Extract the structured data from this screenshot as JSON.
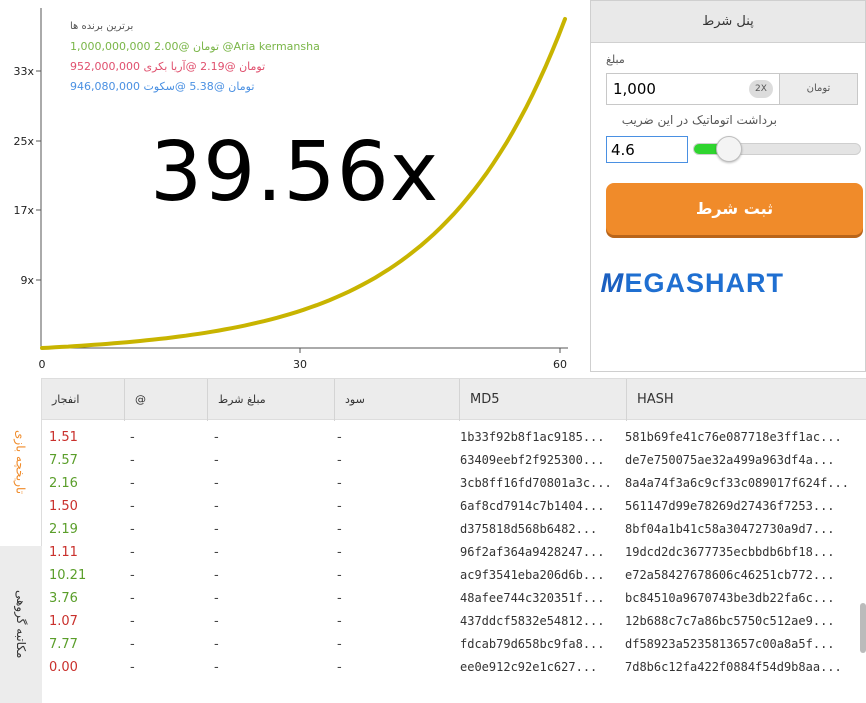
{
  "chart": {
    "multiplier_text": "39.56x",
    "curve_color": "#c8b400",
    "x_ticks": [
      "0",
      "30",
      "60"
    ],
    "y_ticks": [
      "9x",
      "17x",
      "25x",
      "33x"
    ],
    "top_winners": {
      "title": "برترین برنده ها",
      "entries": [
        {
          "text": "1,000,000,000 تومان @2.00 @Aria kermansha",
          "color": "#7ab648"
        },
        {
          "text": "952,000,000 تومان @2.19 @آریا بکری",
          "color": "#e0506e"
        },
        {
          "text": "946,080,000 تومان @5.38 @سکوت",
          "color": "#4a90e2"
        }
      ]
    }
  },
  "bet_panel": {
    "title": "پنل شرط",
    "amount_label": "مبلغ",
    "amount_value": "1,000",
    "double_label": "2X",
    "currency_label": "تومان",
    "auto_cashout_label": "برداشت اتوماتیک در این ضریب",
    "auto_cashout_value": "4.6",
    "slider_fill_fraction": 0.22,
    "submit_label": "ثبت شرط",
    "logo_m": "M",
    "logo_rest": "EGASHART",
    "accent_color": "#f08b2a",
    "slider_color": "#2fd52f"
  },
  "side_tabs": {
    "history": "تاریخچه بازی",
    "chat": "مکاتبه گروهی"
  },
  "table": {
    "headers": {
      "crash": "انفجار",
      "at": "@",
      "bet": "مبلغ شرط",
      "profit": "سود",
      "md5": "MD5",
      "hash": "HASH"
    },
    "rows": [
      {
        "crash": "1.51",
        "status": "red",
        "at": "-",
        "bet": "-",
        "profit": "-",
        "md5": "1b33f92b8f1ac9185...",
        "hash": "581b69fe41c76e087718e3ff1ac..."
      },
      {
        "crash": "7.57",
        "status": "green",
        "at": "-",
        "bet": "-",
        "profit": "-",
        "md5": "63409eebf2f925300...",
        "hash": "de7e750075ae32a499a963df4a..."
      },
      {
        "crash": "2.16",
        "status": "green",
        "at": "-",
        "bet": "-",
        "profit": "-",
        "md5": "3cb8ff16fd70801a3c...",
        "hash": "8a4a74f3a6c9cf33c089017f624f..."
      },
      {
        "crash": "1.50",
        "status": "red",
        "at": "-",
        "bet": "-",
        "profit": "-",
        "md5": "6af8cd7914c7b1404...",
        "hash": "561147d99e78269d27436f7253..."
      },
      {
        "crash": "2.19",
        "status": "green",
        "at": "-",
        "bet": "-",
        "profit": "-",
        "md5": "d375818d568b6482...",
        "hash": "8bf04a1b41c58a30472730a9d7..."
      },
      {
        "crash": "1.11",
        "status": "red",
        "at": "-",
        "bet": "-",
        "profit": "-",
        "md5": "96f2af364a9428247...",
        "hash": "19dcd2dc3677735ecbbdb6bf18..."
      },
      {
        "crash": "10.21",
        "status": "green",
        "at": "-",
        "bet": "-",
        "profit": "-",
        "md5": "ac9f3541eba206d6b...",
        "hash": "e72a58427678606c46251cb772..."
      },
      {
        "crash": "3.76",
        "status": "green",
        "at": "-",
        "bet": "-",
        "profit": "-",
        "md5": "48afee744c320351f...",
        "hash": "bc84510a9670743be3db22fa6c..."
      },
      {
        "crash": "1.07",
        "status": "red",
        "at": "-",
        "bet": "-",
        "profit": "-",
        "md5": "437ddcf5832e54812...",
        "hash": "12b688c7c7a86bc5750c512ae9..."
      },
      {
        "crash": "7.77",
        "status": "green",
        "at": "-",
        "bet": "-",
        "profit": "-",
        "md5": "fdcab79d658bc9fa8...",
        "hash": "df58923a5235813657c00a8a5f..."
      },
      {
        "crash": "0.00",
        "status": "red",
        "at": "-",
        "bet": "-",
        "profit": "-",
        "md5": "ee0e912c92e1c627...",
        "hash": "7d8b6c12fa422f0884f54d9b8aa..."
      }
    ]
  }
}
